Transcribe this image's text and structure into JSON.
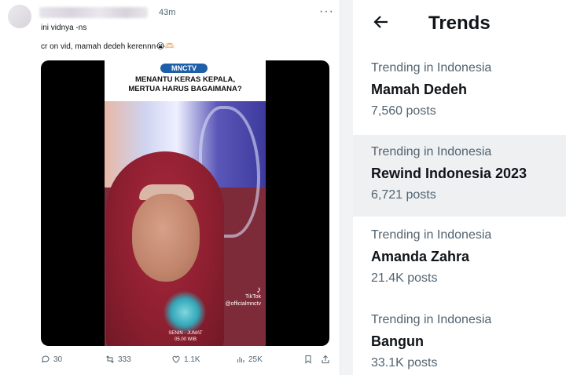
{
  "tweet": {
    "time": "43m",
    "more": "···",
    "text_line1": "ini vidnya -ns",
    "text_line2": "cr on vid, mamah dedeh kerennn😭🫶🏻",
    "video": {
      "channel_logo": "MNCTV",
      "headline_line1": "MENANTU KERAS KEPALA,",
      "headline_line2": "MERTUA HARUS BAGAIMANA?",
      "tiktok_label": "TikTok",
      "tiktok_handle": "@officialmnctv",
      "schedule_line1": "SENIN - JUMAT",
      "schedule_line2": "05.00 WIB"
    },
    "actions": {
      "replies": "30",
      "reposts": "333",
      "likes": "1.1K",
      "views": "25K"
    }
  },
  "trends": {
    "title": "Trends",
    "items": [
      {
        "context": "Trending in Indonesia",
        "name": "Mamah Dedeh",
        "count": "7,560 posts"
      },
      {
        "context": "Trending in Indonesia",
        "name": "Rewind Indonesia 2023",
        "count": "6,721 posts"
      },
      {
        "context": "Trending in Indonesia",
        "name": "Amanda Zahra",
        "count": "21.4K posts"
      },
      {
        "context": "Trending in Indonesia",
        "name": "Bangun",
        "count": "33.1K posts"
      }
    ]
  },
  "colors": {
    "accent_text": "#0f1419",
    "secondary_text": "#536471",
    "highlight_row": "#eef0f2"
  }
}
